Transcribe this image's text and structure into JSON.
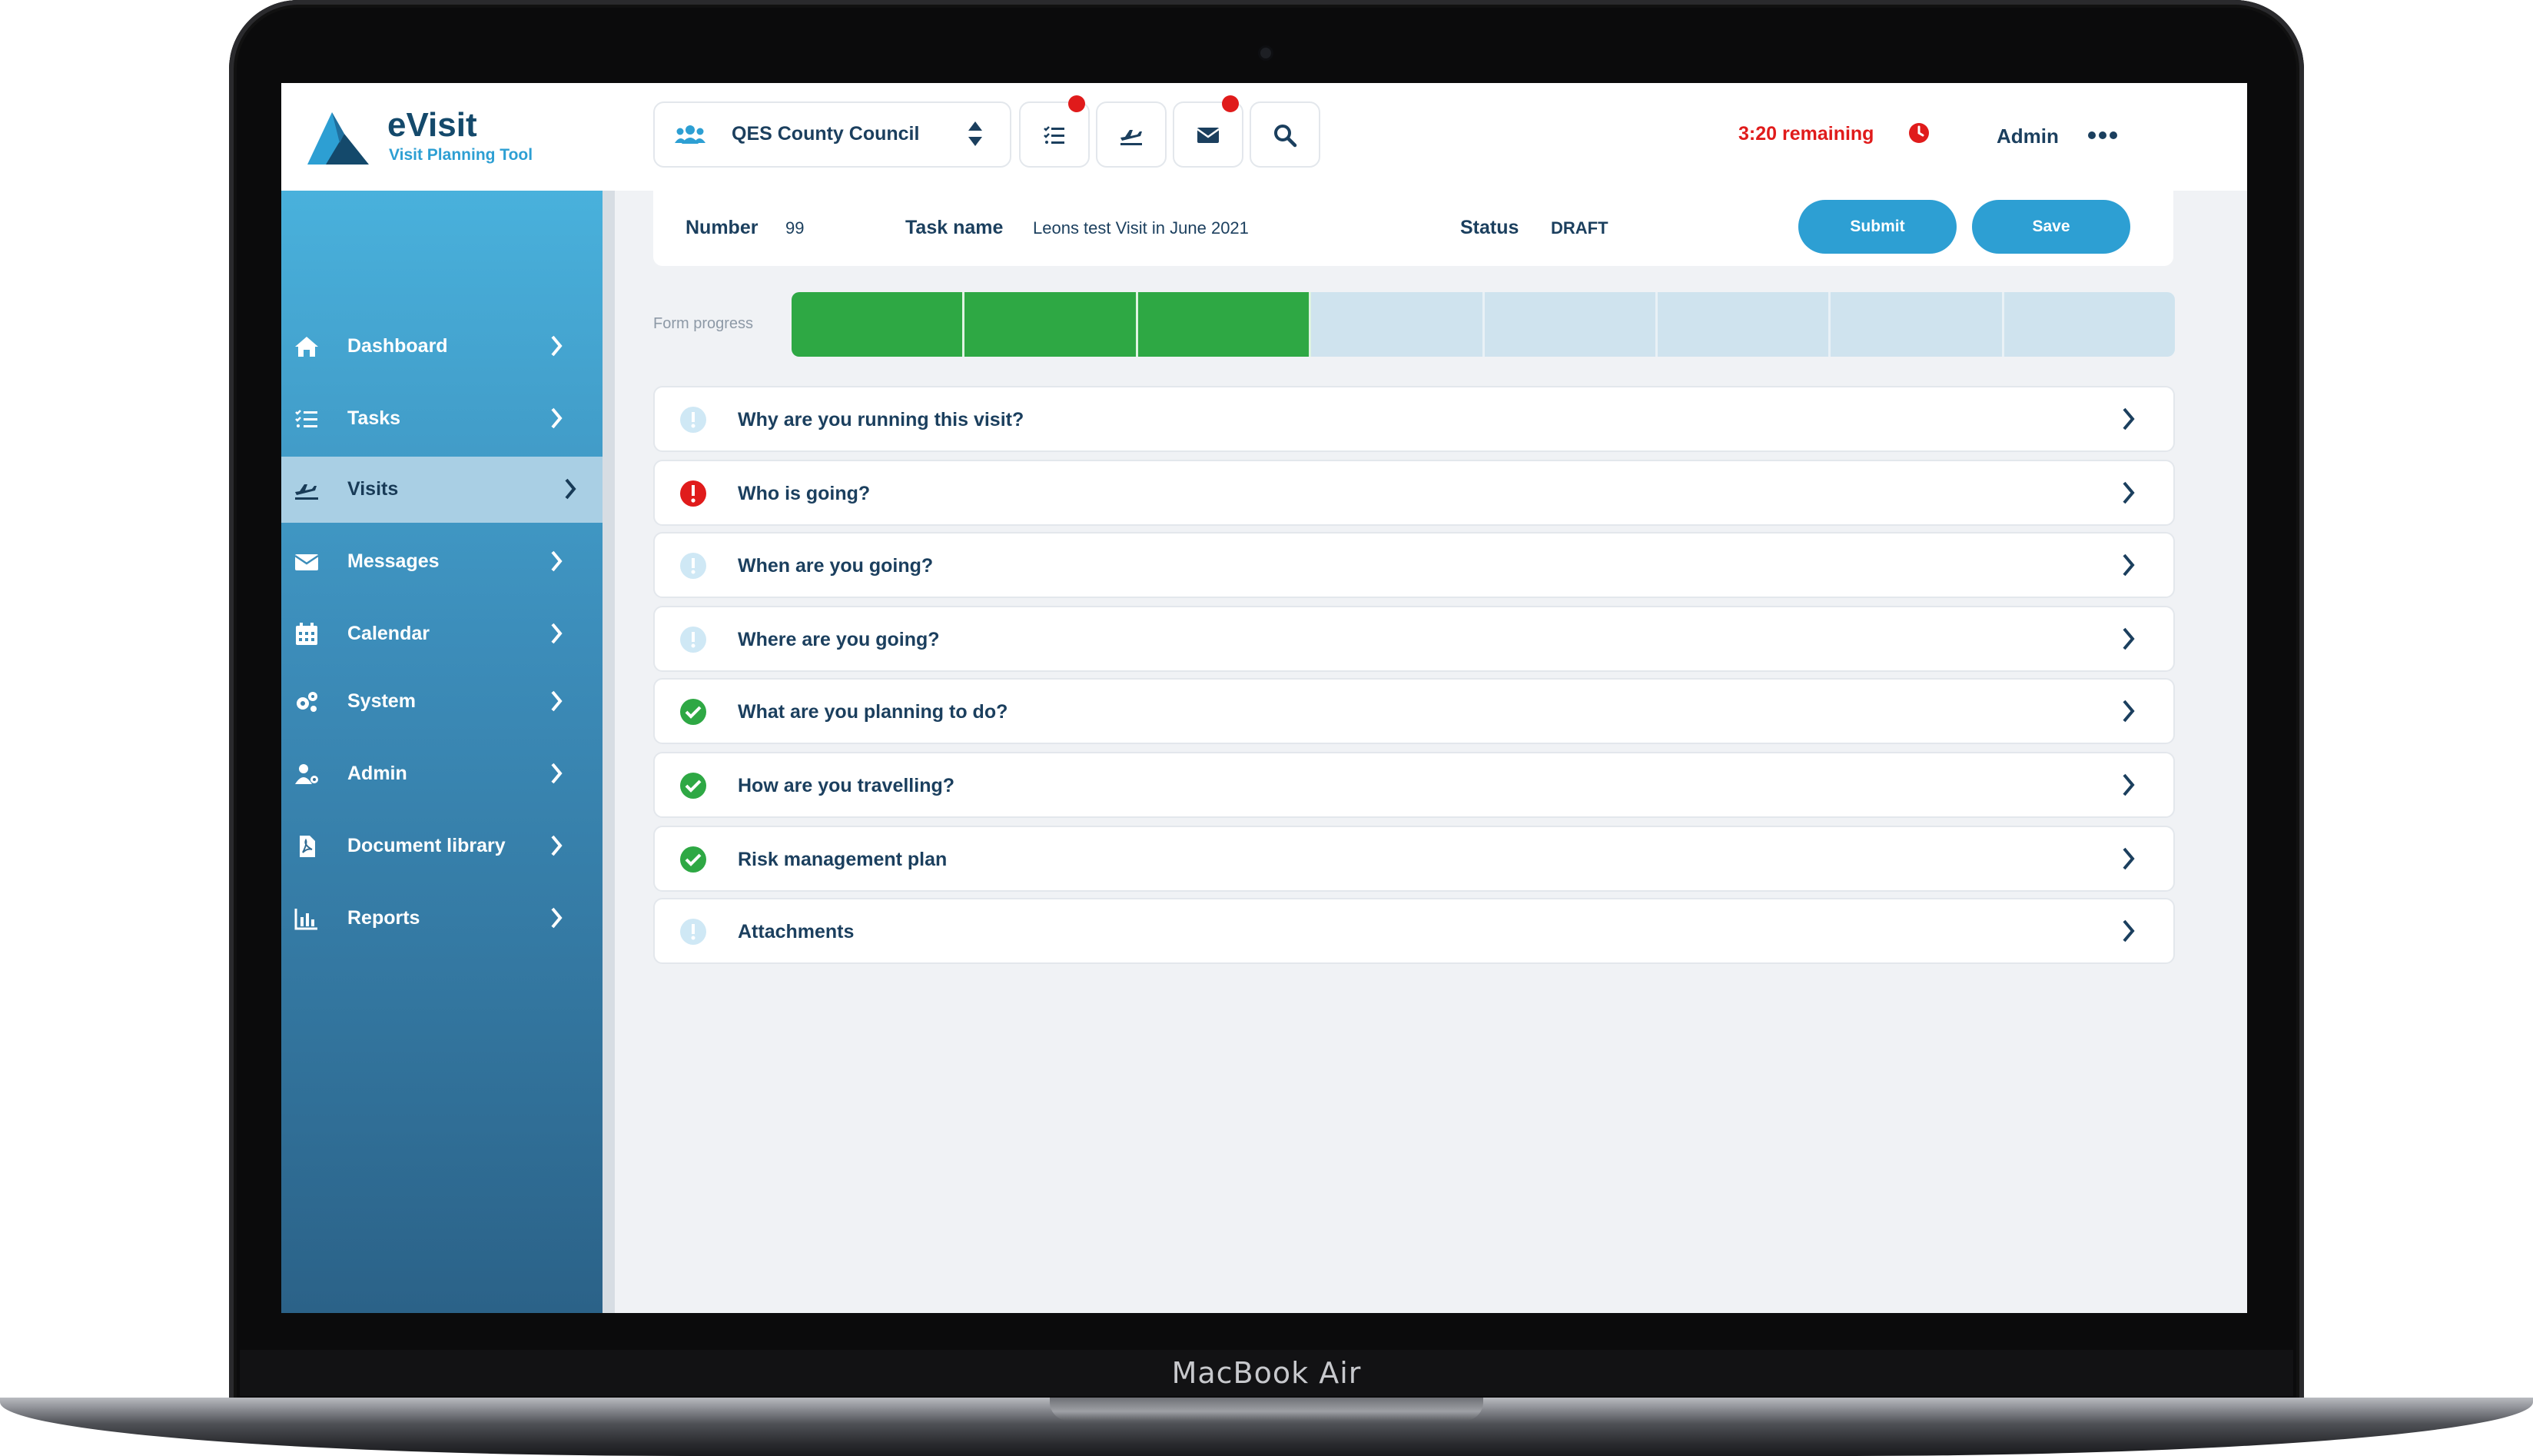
{
  "device_label": "MacBook Air",
  "brand": {
    "name": "eVisit",
    "subtitle": "Visit Planning Tool"
  },
  "topbar": {
    "organisation": "QES County Council",
    "icon_buttons": [
      {
        "icon": "task-list-icon",
        "has_badge": true
      },
      {
        "icon": "plane-icon",
        "has_badge": false
      },
      {
        "icon": "envelope-icon",
        "has_badge": true
      },
      {
        "icon": "search-icon",
        "has_badge": false
      }
    ],
    "timer": "3:20 remaining",
    "user": "Admin"
  },
  "sidebar": {
    "items": [
      {
        "label": "Dashboard",
        "icon": "home-icon"
      },
      {
        "label": "Tasks",
        "icon": "task-list-icon"
      },
      {
        "label": "Visits",
        "icon": "plane-icon",
        "active": true
      },
      {
        "label": "Messages",
        "icon": "envelope-icon"
      },
      {
        "label": "Calendar",
        "icon": "calendar-icon"
      },
      {
        "label": "System",
        "icon": "gears-icon"
      },
      {
        "label": "Admin",
        "icon": "user-cog-icon"
      },
      {
        "label": "Document library",
        "icon": "pdf-file-icon"
      },
      {
        "label": "Reports",
        "icon": "bar-chart-icon"
      }
    ]
  },
  "task": {
    "number_label": "Number",
    "number": "99",
    "name_label": "Task name",
    "name": "Leons test Visit in June 2021",
    "status_label": "Status",
    "status": "DRAFT",
    "submit_label": "Submit",
    "save_label": "Save"
  },
  "progress": {
    "label": "Form progress",
    "completed_segments": 3,
    "total_segments": 8
  },
  "sections": [
    {
      "label": "Why are you running this visit?",
      "status": "info"
    },
    {
      "label": "Who is going?",
      "status": "error"
    },
    {
      "label": "When are you going?",
      "status": "info"
    },
    {
      "label": "Where are you going?",
      "status": "info"
    },
    {
      "label": "What are you planning to do?",
      "status": "complete"
    },
    {
      "label": "How are you travelling?",
      "status": "complete"
    },
    {
      "label": "Risk management plan",
      "status": "complete"
    },
    {
      "label": "Attachments",
      "status": "info"
    }
  ],
  "colors": {
    "accent": "#2d9fd3",
    "navy": "#1b3f5e",
    "error": "#e01b1b",
    "success": "#2ea844",
    "info": "#cfe8f5"
  }
}
